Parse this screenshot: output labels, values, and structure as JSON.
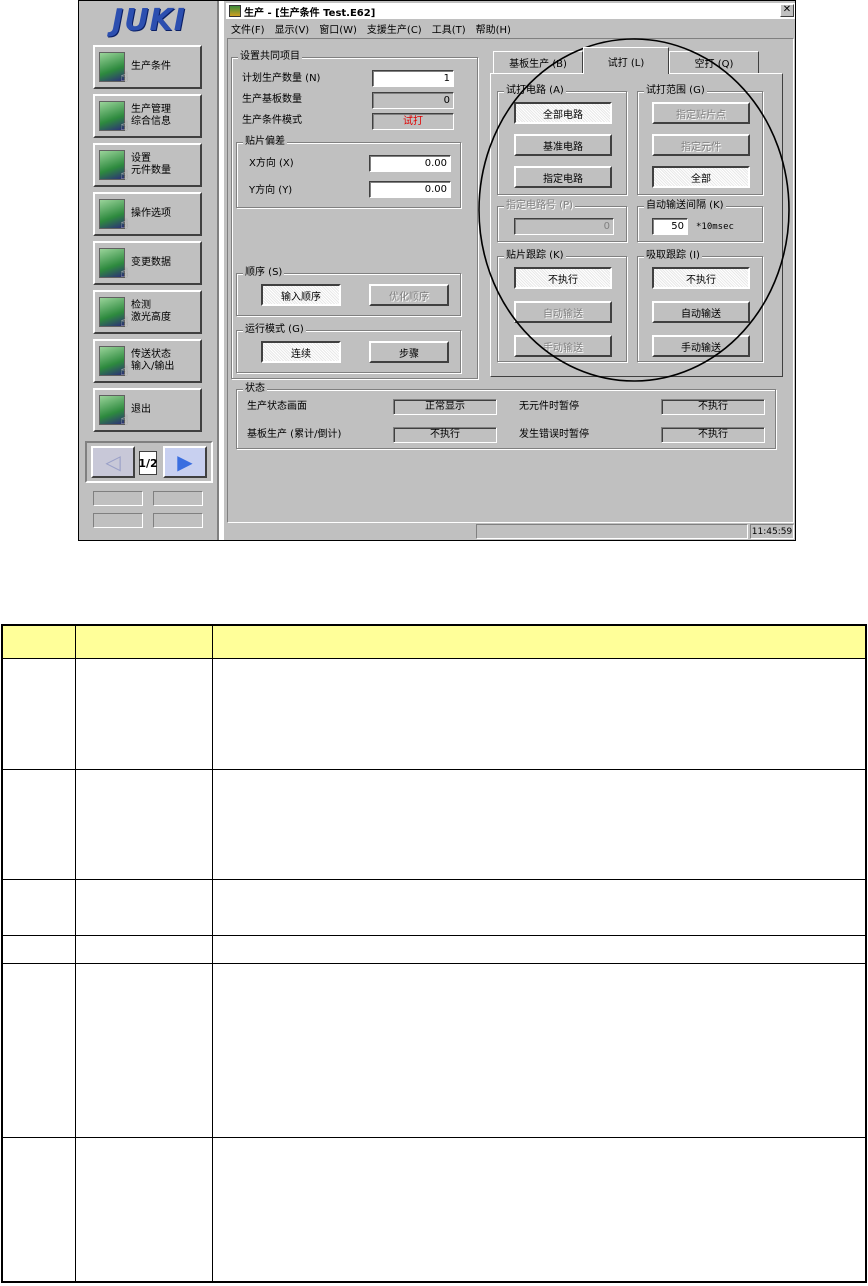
{
  "sidebar": {
    "logo": "JUKI",
    "buttons": [
      {
        "label": "生产条件",
        "icon": "production-condition-icon"
      },
      {
        "label": "生产管理\n综合信息",
        "icon": "management-info-icon"
      },
      {
        "label": "设置\n元件数量",
        "icon": "component-count-icon"
      },
      {
        "label": "操作选项",
        "icon": "operation-options-icon"
      },
      {
        "label": "变更数据",
        "icon": "change-data-icon"
      },
      {
        "label": "检测\n激光高度",
        "icon": "laser-height-icon"
      },
      {
        "label": "传送状态\n输入/输出",
        "icon": "conveyor-io-icon"
      },
      {
        "label": "退出",
        "icon": "exit-icon"
      }
    ],
    "page_indicator": "1/2"
  },
  "window": {
    "title": "生产 - [生产条件 Test.E62]",
    "menu": [
      "文件(F)",
      "显示(V)",
      "窗口(W)",
      "支援生产(C)",
      "工具(T)",
      "帮助(H)"
    ],
    "status_time": "11:45:59"
  },
  "common": {
    "group_title": "设置共同项目",
    "planned_qty_label": "计划生产数量 (N)",
    "planned_qty_value": "1",
    "board_count_label": "生产基板数量",
    "board_count_value": "0",
    "mode_label": "生产条件模式",
    "mode_value": "试打",
    "offset_group": "贴片偏差",
    "x_label": "X方向 (X)",
    "x_value": "0.00",
    "y_label": "Y方向 (Y)",
    "y_value": "0.00",
    "sequence_group": "顺序 (S)",
    "seq_input": "输入顺序",
    "seq_optimize": "优化顺序",
    "run_group": "运行模式 (G)",
    "run_continuous": "连续",
    "run_step": "步骤"
  },
  "tabs": [
    "基板生产 (B)",
    "试打 (L)",
    "空打 (Q)"
  ],
  "trial": {
    "circuit_group": "试打电路 (A)",
    "all_circuits": "全部电路",
    "base_circuit": "基准电路",
    "specified_circuit": "指定电路",
    "range_group": "试打范围 (G)",
    "specify_point": "指定贴片点",
    "specify_component": "指定元件",
    "range_all": "全部",
    "circuit_no_group": "指定电路号 (P)",
    "circuit_no_value": "0",
    "interval_group": "自动输送间隔 (K)",
    "interval_value": "50",
    "interval_unit": "*10msec",
    "mount_track_group": "贴片跟踪 (K)",
    "mount_not_exec": "不执行",
    "mount_auto": "自动输送",
    "mount_manual": "手动输送",
    "pick_track_group": "吸取跟踪 (I)",
    "pick_not_exec": "不执行",
    "pick_auto": "自动输送",
    "pick_manual": "手动输送"
  },
  "status": {
    "group_title": "状态",
    "screen_label": "生产状态画面",
    "screen_value": "正常显示",
    "no_comp_label": "无元件时暂停",
    "no_comp_value": "不执行",
    "board_prod_label": "基板生产 (累计/倒计)",
    "board_prod_value": "不执行",
    "error_label": "发生错误时暂停",
    "error_value": "不执行"
  }
}
